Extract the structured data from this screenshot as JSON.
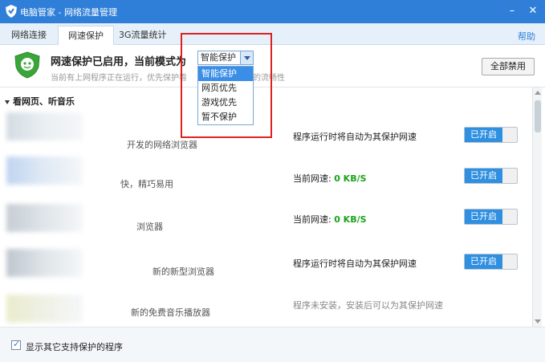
{
  "window": {
    "title": "电脑管家 - 网络流量管理",
    "minimize_glyph": "–",
    "close_glyph": "✕"
  },
  "tabs": [
    {
      "label": "网络连接",
      "active": false
    },
    {
      "label": "网速保护",
      "active": true
    },
    {
      "label": "3G流量统计",
      "active": false
    }
  ],
  "help_label": "帮助",
  "header": {
    "status_title": "网速保护已启用，当前模式为",
    "status_sub": "当前有上网程序正在运行，优先保护看",
    "status_sub_tail": "的流畅性",
    "mode_value": "智能保护",
    "disable_all_label": "全部禁用"
  },
  "dropdown": {
    "options": [
      "智能保护",
      "网页优先",
      "游戏优先",
      "暂不保护"
    ],
    "selected_index": 0
  },
  "section": {
    "label": "看网页、听音乐"
  },
  "rows": [
    {
      "desc": "开发的网络浏览器",
      "status_text": "程序运行时将自动为其保护网速",
      "speed": "",
      "toggle_label": "已开启",
      "has_toggle": true
    },
    {
      "desc": "快，精巧易用",
      "status_text": "当前网速: ",
      "speed": "0 KB/S",
      "toggle_label": "已开启",
      "has_toggle": true
    },
    {
      "desc": "浏览器",
      "status_text": "当前网速: ",
      "speed": "0 KB/S",
      "toggle_label": "已开启",
      "has_toggle": true
    },
    {
      "desc": "新的新型浏览器",
      "status_text": "程序运行时将自动为其保护网速",
      "speed": "",
      "toggle_label": "已开启",
      "has_toggle": true
    },
    {
      "desc": "新的免费音乐播放器",
      "status_text": "程序未安装，安装后可以为其保护网速",
      "speed": "",
      "toggle_label": "",
      "has_toggle": false
    }
  ],
  "footer": {
    "checkbox_label": "显示其它支持保护的程序",
    "checked": true
  },
  "colors": {
    "accent": "#2f7fd8",
    "toggle_on": "#2f8fe0",
    "speed_green": "#1aa31a",
    "highlight_red": "#e02020"
  }
}
